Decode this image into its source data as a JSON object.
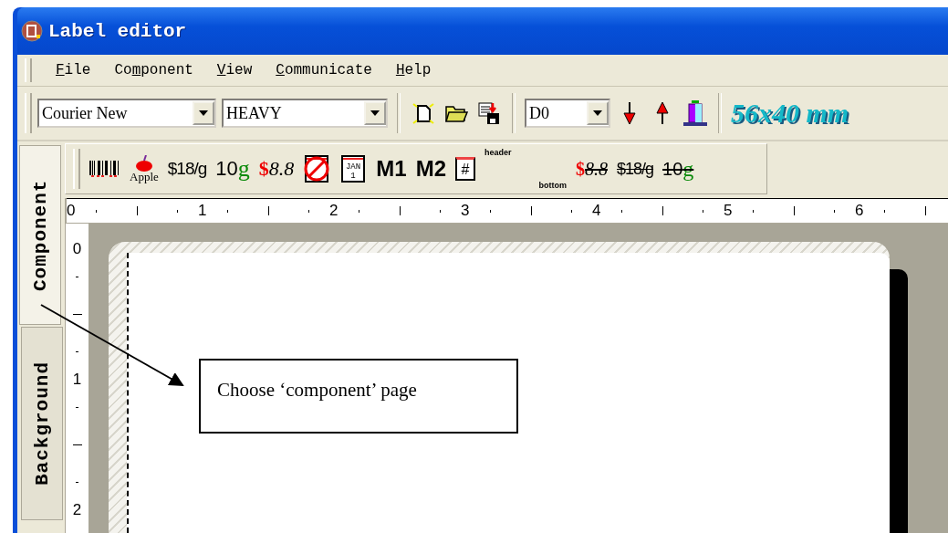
{
  "window": {
    "title": "Label editor"
  },
  "menu": [
    {
      "key": "F",
      "after": "ile"
    },
    {
      "before": "Co",
      "key": "m",
      "after": "ponent"
    },
    {
      "key": "V",
      "after": "iew"
    },
    {
      "key": "C",
      "after": "ommunicate"
    },
    {
      "key": "H",
      "after": "elp"
    }
  ],
  "toolbar": {
    "font_family": "Courier New",
    "font_style": "HEAVY",
    "device": "D0",
    "label_size": "56x40 mm"
  },
  "tabs": [
    {
      "label": "Component",
      "selected": true
    },
    {
      "label": "Background",
      "selected": false
    }
  ],
  "component_tools": [
    {
      "kind": "barcode"
    },
    {
      "kind": "apple",
      "label": "Apple"
    },
    {
      "kind": "unit-price",
      "label": "$18/g"
    },
    {
      "kind": "weight",
      "label": "10",
      "unit": "g"
    },
    {
      "kind": "price",
      "currency": "$",
      "label": "8.8"
    },
    {
      "kind": "date-off"
    },
    {
      "kind": "date",
      "month": "JAN",
      "day": "1"
    },
    {
      "kind": "text",
      "label": "M1"
    },
    {
      "kind": "text",
      "label": "M2"
    },
    {
      "kind": "counter",
      "label": "#"
    },
    {
      "kind": "header-bottom",
      "top": "header",
      "bottom": "bottom"
    },
    {
      "kind": "price-struck",
      "currency": "$",
      "label": "8.8"
    },
    {
      "kind": "unit-price-struck",
      "label": "$18/g"
    },
    {
      "kind": "weight-struck",
      "label": "10",
      "unit": "g"
    }
  ],
  "ruler": {
    "horizontal": [
      "0",
      "1",
      "2",
      "3",
      "4",
      "5",
      "6"
    ],
    "vertical": [
      "0",
      "1",
      "2"
    ]
  },
  "callout": {
    "text": "Choose ‘component’ page"
  }
}
